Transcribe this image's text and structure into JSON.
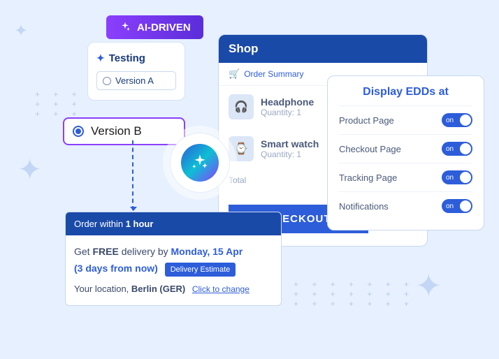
{
  "badge": {
    "label": "AI-DRIVEN"
  },
  "testing": {
    "title": "Testing",
    "version_a": "Version A",
    "version_b": "Version B"
  },
  "shop": {
    "header": "Shop",
    "order_summary": "Order Summary",
    "items": [
      {
        "name": "Headphone",
        "qty": "Quantity: 1"
      },
      {
        "name": "Smart watch",
        "qty": "Quantity: 1"
      }
    ],
    "total_label": "Total",
    "checkout": "CHECKOUT"
  },
  "edd": {
    "title": "Display EDDs at",
    "rows": [
      {
        "label": "Product Page",
        "state": "on"
      },
      {
        "label": "Checkout Page",
        "state": "on"
      },
      {
        "label": "Tracking Page",
        "state": "on"
      },
      {
        "label": "Notifications",
        "state": "on"
      }
    ]
  },
  "delivery": {
    "header_prefix": "Order within ",
    "header_bold": "1 hour",
    "line1_prefix": "Get ",
    "line1_free": "FREE",
    "line1_mid": " delivery by ",
    "line1_date": "Monday, 15 Apr",
    "line2_date": "(3 days from now)",
    "estimate_btn": "Delivery Estimate",
    "loc_prefix": "Your location, ",
    "loc_bold": "Berlin (GER)",
    "change": "Click to change"
  }
}
